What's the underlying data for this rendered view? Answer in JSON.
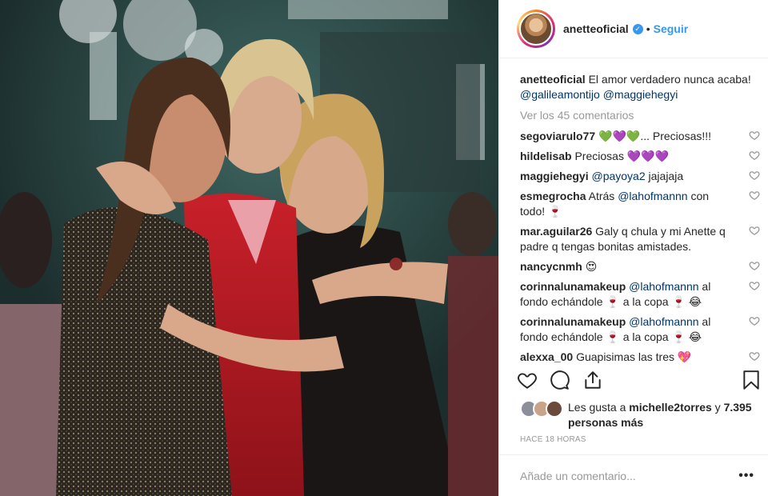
{
  "header": {
    "username": "anetteoficial",
    "separator": "•",
    "follow_label": "Seguir"
  },
  "caption": {
    "username": "anetteoficial",
    "text": "El amor verdadero nunca acaba!",
    "mention_1": "@galileamontijo",
    "mention_2": "@maggiehegyi"
  },
  "view_all_label": "Ver los 45 comentarios",
  "comments": [
    {
      "user": "segoviarulo77",
      "pre": "",
      "mention": "",
      "text": "💚💜💚... Preciosas!!!"
    },
    {
      "user": "hildelisab",
      "pre": "",
      "mention": "",
      "text": "Preciosas 💜💜💜"
    },
    {
      "user": "maggiehegyi",
      "pre": "",
      "mention": "@payoya2",
      "text": " jajajaja"
    },
    {
      "user": "esmegrocha",
      "pre": "Atrás ",
      "mention": "@lahofmannn",
      "text": " con todo! 🍷"
    },
    {
      "user": "mar.aguilar26",
      "pre": "",
      "mention": "",
      "text": "Galy q chula y mi Anette q padre q tengas bonitas amistades."
    },
    {
      "user": "nancycnmh",
      "pre": "",
      "mention": "",
      "text": "😍"
    },
    {
      "user": "corinnalunamakeup",
      "pre": "",
      "mention": "@lahofmannn",
      "text": " al fondo echándole 🍷 a la copa 🍷 😂"
    },
    {
      "user": "corinnalunamakeup",
      "pre": "",
      "mention": "@lahofmannn",
      "text": " al fondo echándole 🍷 a la copa 🍷 😂"
    },
    {
      "user": "alexxa_00",
      "pre": "",
      "mention": "",
      "text": "Guapisimas las tres 💖"
    }
  ],
  "likes": {
    "prefix": "Les gusta a",
    "user": "michelle2torres",
    "middle": "y",
    "others": "7.395 personas más"
  },
  "timestamp": "HACE 18 HORAS",
  "add_comment_placeholder": "Añade un comentario...",
  "more_label": "•••",
  "colors": {
    "link": "#3897f0",
    "mention": "#003569",
    "muted": "#999999",
    "text": "#262626",
    "border": "#efefef"
  },
  "icons": [
    "verified-badge-icon",
    "heart-icon",
    "comment-icon",
    "share-icon",
    "bookmark-icon",
    "more-options-icon"
  ]
}
